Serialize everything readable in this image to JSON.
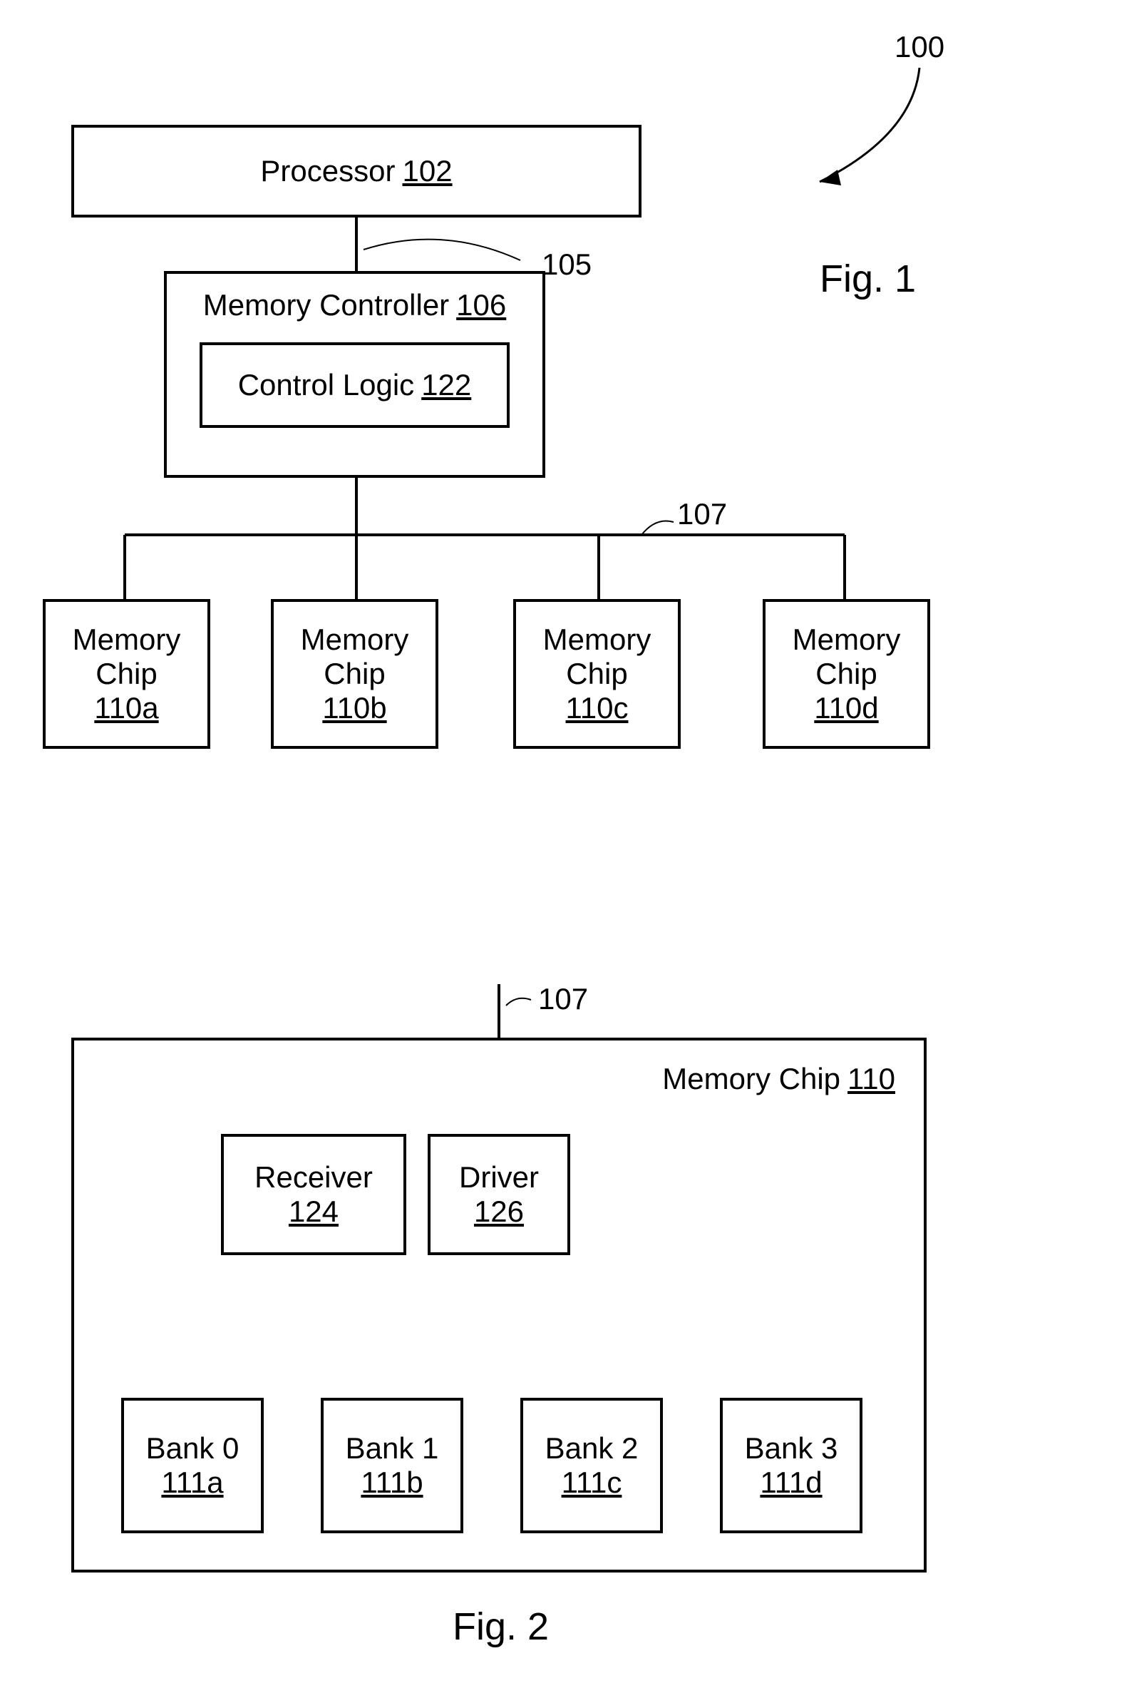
{
  "fig1": {
    "ref_system": "100",
    "processor": {
      "name": "Processor",
      "num": "102"
    },
    "mem_ctrl": {
      "name": "Memory Controller",
      "num": "106"
    },
    "ctrl_logic": {
      "name": "Control Logic",
      "num": "122"
    },
    "bus_top": "105",
    "bus_bottom": "107",
    "chips": [
      {
        "name": "Memory Chip",
        "num": "110a"
      },
      {
        "name": "Memory Chip",
        "num": "110b"
      },
      {
        "name": "Memory Chip",
        "num": "110c"
      },
      {
        "name": "Memory Chip",
        "num": "110d"
      }
    ],
    "caption": "Fig. 1"
  },
  "fig2": {
    "bus": "107",
    "mem_chip": {
      "name": "Memory Chip",
      "num": "110"
    },
    "receiver": {
      "name": "Receiver",
      "num": "124"
    },
    "driver": {
      "name": "Driver",
      "num": "126"
    },
    "banks": [
      {
        "name": "Bank 0",
        "num": "111a"
      },
      {
        "name": "Bank 1",
        "num": "111b"
      },
      {
        "name": "Bank 2",
        "num": "111c"
      },
      {
        "name": "Bank 3",
        "num": "111d"
      }
    ],
    "caption": "Fig. 2"
  }
}
